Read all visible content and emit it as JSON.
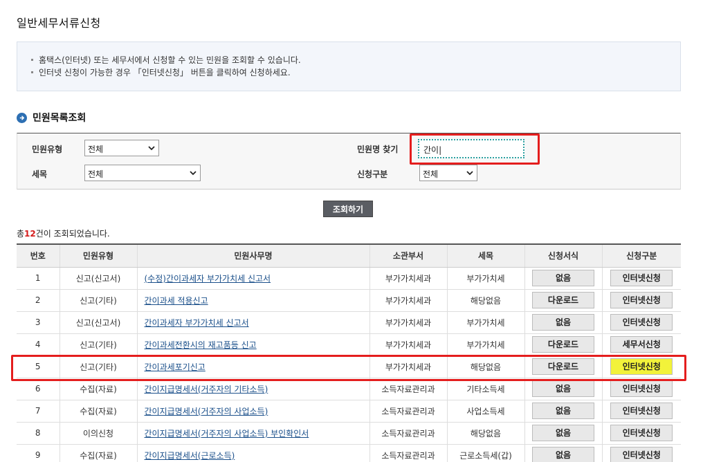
{
  "page": {
    "title": "일반세무서류신청",
    "info_lines": [
      "홈택스(인터넷) 또는 세무서에서 신청할 수 있는 민원을 조회할 수 있습니다.",
      "인터넷 신청이 가능한 경우 「인터넷신청」 버튼을 클릭하여 신청하세요."
    ]
  },
  "search": {
    "section_title": "민원목록조회",
    "type_label": "민원유형",
    "type_value": "전체",
    "tax_label": "세목",
    "tax_value": "전체",
    "name_label": "민원명 찾기",
    "name_value": "간이|",
    "apply_label": "신청구분",
    "apply_value": "전체",
    "button": "조회하기"
  },
  "result": {
    "prefix": "총",
    "count": "12",
    "suffix": "건이 조회되었습니다."
  },
  "table": {
    "headers": [
      "번호",
      "민원유형",
      "민원사무명",
      "소관부서",
      "세목",
      "신청서식",
      "신청구분"
    ],
    "rows": [
      {
        "no": "1",
        "type": "신고(신고서)",
        "name": "(수정)간이과세자 부가가치세 신고서",
        "dept": "부가가치세과",
        "tax": "부가가치세",
        "form": "없음",
        "apply": "인터넷신청"
      },
      {
        "no": "2",
        "type": "신고(기타)",
        "name": "간이과세 적용신고",
        "dept": "부가가치세과",
        "tax": "해당없음",
        "form": "다운로드",
        "apply": "인터넷신청"
      },
      {
        "no": "3",
        "type": "신고(신고서)",
        "name": "간이과세자 부가가치세 신고서",
        "dept": "부가가치세과",
        "tax": "부가가치세",
        "form": "없음",
        "apply": "인터넷신청"
      },
      {
        "no": "4",
        "type": "신고(기타)",
        "name": "간이과세전환시의 재고품등 신고",
        "dept": "부가가치세과",
        "tax": "부가가치세",
        "form": "다운로드",
        "apply": "세무서신청"
      },
      {
        "no": "5",
        "type": "신고(기타)",
        "name": "간이과세포기신고",
        "dept": "부가가치세과",
        "tax": "해당없음",
        "form": "다운로드",
        "apply": "인터넷신청"
      },
      {
        "no": "6",
        "type": "수집(자료)",
        "name": "간이지급명세서(거주자의 기타소득)",
        "dept": "소득자료관리과",
        "tax": "기타소득세",
        "form": "없음",
        "apply": "인터넷신청"
      },
      {
        "no": "7",
        "type": "수집(자료)",
        "name": "간이지급명세서(거주자의 사업소득)",
        "dept": "소득자료관리과",
        "tax": "사업소득세",
        "form": "없음",
        "apply": "인터넷신청"
      },
      {
        "no": "8",
        "type": "이의신청",
        "name": "간이지급명세서(거주자의 사업소득) 부인확인서",
        "dept": "소득자료관리과",
        "tax": "해당없음",
        "form": "없음",
        "apply": "인터넷신청"
      },
      {
        "no": "9",
        "type": "수집(자료)",
        "name": "간이지급명세서(근로소득)",
        "dept": "소득자료관리과",
        "tax": "근로소득세(갑)",
        "form": "없음",
        "apply": "인터넷신청"
      }
    ]
  },
  "colors": {
    "highlight_box": "#e41d1d",
    "highlight_button": "#f2f23a",
    "link": "#1a4f8a",
    "count": "#d41c1c"
  }
}
